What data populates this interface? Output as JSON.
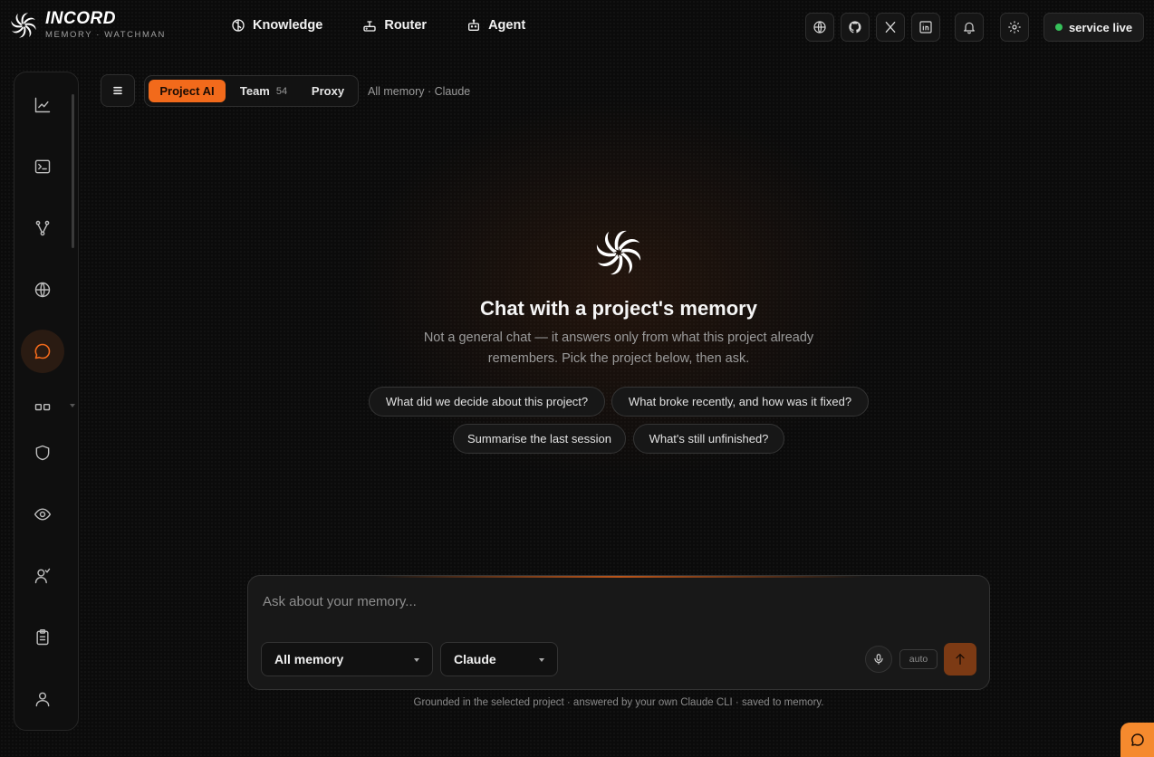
{
  "brand": {
    "name": "INCORD",
    "subtitle": "MEMORY · WATCHMAN"
  },
  "nav": [
    {
      "label": "Knowledge",
      "icon": "brain-icon"
    },
    {
      "label": "Router",
      "icon": "router-icon"
    },
    {
      "label": "Agent",
      "icon": "robot-icon"
    }
  ],
  "top_actions": [
    "globe-icon",
    "github-icon",
    "x-icon",
    "linkedin-icon",
    "bell-icon",
    "settings-icon"
  ],
  "status": {
    "label": "service live",
    "color": "#36c15a"
  },
  "sidebar": {
    "items": [
      {
        "icon": "chart-line-icon",
        "active": false
      },
      {
        "icon": "terminal-icon",
        "active": false
      },
      {
        "icon": "branch-icon",
        "active": false
      },
      {
        "icon": "globe-icon",
        "active": false
      },
      {
        "icon": "chat-bubble-icon",
        "active": true
      },
      {
        "icon": "grid-icon",
        "active": false
      },
      {
        "icon": "shield-icon",
        "active": false
      },
      {
        "icon": "eye-icon",
        "active": false
      },
      {
        "icon": "user-check-icon",
        "active": false
      },
      {
        "icon": "clipboard-icon",
        "active": false
      },
      {
        "icon": "user-icon",
        "active": false
      }
    ]
  },
  "toolbar": {
    "tabs": [
      {
        "label": "Project AI",
        "active": true,
        "count": ""
      },
      {
        "label": "Team",
        "active": false,
        "count": "54"
      },
      {
        "label": "Proxy",
        "active": false,
        "count": ""
      }
    ],
    "context": "All memory · Claude"
  },
  "hero": {
    "title": "Chat with a project's memory",
    "description": "Not a general chat — it answers only from what this project already remembers. Pick the project below, then ask."
  },
  "suggestions": [
    "What did we decide about this project?",
    "What broke recently, and how was it fixed?",
    "Summarise the last session",
    "What's still unfinished?"
  ],
  "composer": {
    "placeholder": "Ask about your memory...",
    "value": "",
    "memory_select": "All memory",
    "model_select": "Claude",
    "auto_label": "auto"
  },
  "footnote": "Grounded in the selected project · answered by your own Claude CLI · saved to memory.",
  "colors": {
    "accent": "#f26a1b",
    "background": "#0b0b0b"
  }
}
